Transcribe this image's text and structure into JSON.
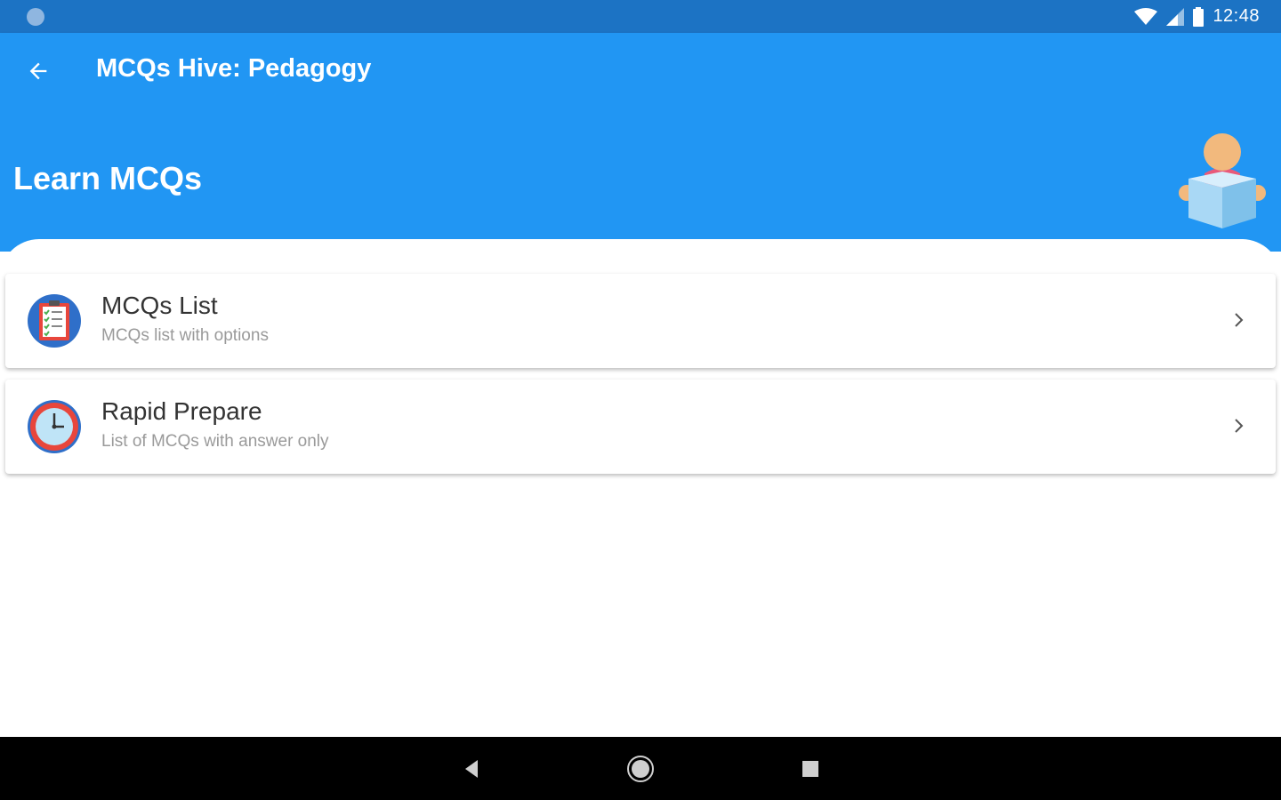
{
  "status_bar": {
    "time": "12:48",
    "icons": [
      "notification-dot-icon",
      "wifi-icon",
      "cell-signal-icon",
      "battery-icon"
    ]
  },
  "app_bar": {
    "title": "MCQs Hive: Pedagogy",
    "back_icon": "arrow-back-icon"
  },
  "header": {
    "title": "Learn MCQs",
    "illustration": "person-reading-book-icon"
  },
  "menu": {
    "items": [
      {
        "title": "MCQs List",
        "subtitle": "MCQs list with options",
        "icon": "checklist-clipboard-icon"
      },
      {
        "title": "Rapid Prepare",
        "subtitle": "List of MCQs with answer only",
        "icon": "clock-icon"
      }
    ]
  },
  "nav_bar": {
    "icons": [
      "nav-back-icon",
      "nav-home-icon",
      "nav-recents-icon"
    ]
  },
  "colors": {
    "status_bar": "#1c73c4",
    "primary": "#2196f3",
    "card_bg": "#ffffff",
    "title_text": "#333333",
    "subtitle_text": "#9a9a9a"
  }
}
